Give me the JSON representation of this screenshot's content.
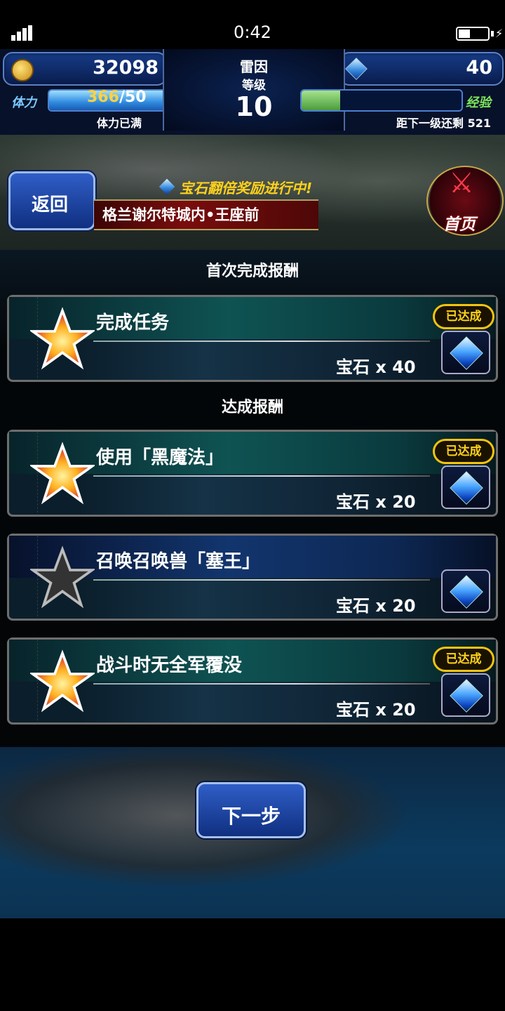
{
  "status_bar": {
    "time": "0:42"
  },
  "hud": {
    "gil": "32098",
    "gems": "40",
    "stamina_label": "体力",
    "stamina_current": "366",
    "stamina_max": "/50",
    "stamina_fill_fraction": 1.0,
    "stamina_status": "体力已满",
    "rank_name": "雷因",
    "rank_sub": "等级",
    "rank_level": "10",
    "exp_label": "经验",
    "exp_fill_fraction": 0.24,
    "exp_remaining": "距下一级还剩 521"
  },
  "header": {
    "back_label": "返回",
    "promo_text": "宝石翻倍奖励进行中!",
    "stage_name": "格兰谢尔特城内•王座前",
    "home_label": "首页"
  },
  "sections": {
    "first_clear_title": "首次完成报酬",
    "achievement_title": "达成报酬"
  },
  "rewards": [
    {
      "task": "完成任务",
      "reward": "宝石 x 40",
      "achieved": true,
      "badge": "已达成"
    },
    {
      "task": "使用「黑魔法」",
      "reward": "宝石 x 20",
      "achieved": true,
      "badge": "已达成"
    },
    {
      "task": "召唤召唤兽「塞王」",
      "reward": "宝石 x 20",
      "achieved": false,
      "badge": ""
    },
    {
      "task": "战斗时无全军覆没",
      "reward": "宝石 x 20",
      "achieved": true,
      "badge": "已达成"
    }
  ],
  "footer": {
    "next_label": "下一步"
  },
  "colors": {
    "accent_gold": "#ffd21a",
    "stamina_blue": "#2f8ae0",
    "exp_green": "#4a9c3c"
  }
}
